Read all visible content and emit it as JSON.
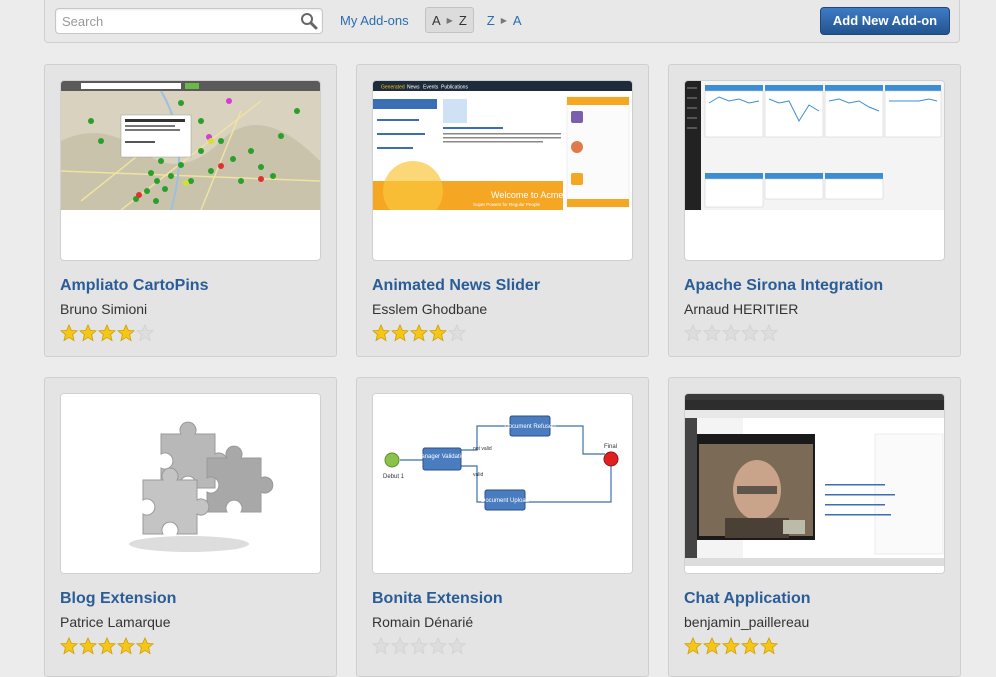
{
  "toolbar": {
    "search_placeholder": "Search",
    "my_addons": "My Add-ons",
    "sort_az": {
      "from": "A",
      "to": "Z"
    },
    "sort_za": {
      "from": "Z",
      "to": "A"
    },
    "add_button": "Add New Add-on"
  },
  "colors": {
    "accent": "#2a5d97",
    "star_on": "#f5c518",
    "star_off": "#dddddd"
  },
  "cards": [
    {
      "title": "Ampliato CartoPins",
      "author": "Bruno Simioni",
      "rating": 4,
      "thumb": "map-screenshot"
    },
    {
      "title": "Animated News Slider",
      "author": "Esslem Ghodbane",
      "rating": 4,
      "thumb": "news-slider-screenshot",
      "thumb_text": {
        "nav": [
          "Generated",
          "News",
          "Events",
          "Publications"
        ],
        "banner": "Welcome to Acme",
        "banner_sub": "Super Powers for Regular People"
      }
    },
    {
      "title": "Apache Sirona Integration",
      "author": "Arnaud HERITIER",
      "rating": 0,
      "thumb": "dashboard-screenshot"
    },
    {
      "title": "Blog Extension",
      "author": "Patrice Lamarque",
      "rating": 5,
      "thumb": "puzzle-icon"
    },
    {
      "title": "Bonita Extension",
      "author": "Romain Dénarié",
      "rating": 0,
      "thumb": "workflow-diagram",
      "thumb_text": {
        "start": "Debut 1",
        "final": "Final",
        "manager": "Manager Validation",
        "refused": "Document Refused",
        "upload": "Document Upload",
        "not_valid": "not valid",
        "valid": "valid"
      }
    },
    {
      "title": "Chat Application",
      "author": "benjamin_paillereau",
      "rating": 5,
      "thumb": "chat-screenshot"
    }
  ]
}
